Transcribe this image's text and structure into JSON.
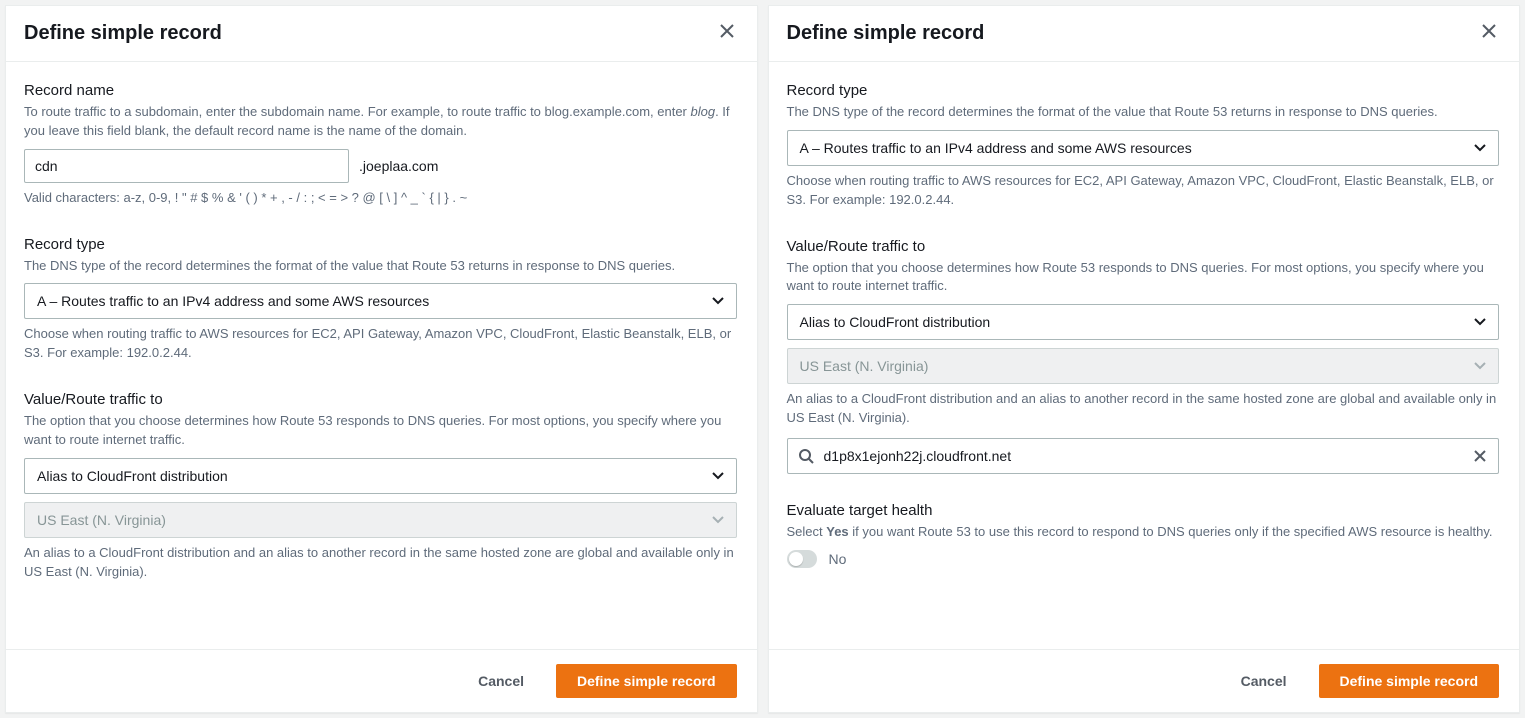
{
  "left": {
    "title": "Define simple record",
    "record_name": {
      "label": "Record name",
      "desc_pre": "To route traffic to a subdomain, enter the subdomain name. For example, to route traffic to blog.example.com, enter ",
      "desc_em": "blog",
      "desc_post": ". If you leave this field blank, the default record name is the name of the domain.",
      "value": "cdn",
      "suffix": ".joeplaa.com",
      "hint": "Valid characters: a-z, 0-9, ! \" # $ % & ' ( ) * + , - / : ; < = > ? @ [ \\ ] ^ _ ` { | } . ~"
    },
    "record_type": {
      "label": "Record type",
      "desc": "The DNS type of the record determines the format of the value that Route 53 returns in response to DNS queries.",
      "value": "A – Routes traffic to an IPv4 address and some AWS resources",
      "hint": "Choose when routing traffic to AWS resources for EC2, API Gateway, Amazon VPC, CloudFront, Elastic Beanstalk, ELB, or S3. For example: 192.0.2.44."
    },
    "route_to": {
      "label": "Value/Route traffic to",
      "desc": "The option that you choose determines how Route 53 responds to DNS queries. For most options, you specify where you want to route internet traffic.",
      "alias_value": "Alias to CloudFront distribution",
      "region_value": "US East (N. Virginia)",
      "hint": "An alias to a CloudFront distribution and an alias to another record in the same hosted zone are global and available only in US East (N. Virginia)."
    },
    "footer": {
      "cancel": "Cancel",
      "primary": "Define simple record"
    }
  },
  "right": {
    "title": "Define simple record",
    "record_type": {
      "label": "Record type",
      "desc": "The DNS type of the record determines the format of the value that Route 53 returns in response to DNS queries.",
      "value": "A – Routes traffic to an IPv4 address and some AWS resources",
      "hint": "Choose when routing traffic to AWS resources for EC2, API Gateway, Amazon VPC, CloudFront, Elastic Beanstalk, ELB, or S3. For example: 192.0.2.44."
    },
    "route_to": {
      "label": "Value/Route traffic to",
      "desc": "The option that you choose determines how Route 53 responds to DNS queries. For most options, you specify where you want to route internet traffic.",
      "alias_value": "Alias to CloudFront distribution",
      "region_value": "US East (N. Virginia)",
      "hint": "An alias to a CloudFront distribution and an alias to another record in the same hosted zone are global and available only in US East (N. Virginia).",
      "search_value": "d1p8x1ejonh22j.cloudfront.net"
    },
    "eval_health": {
      "label": "Evaluate target health",
      "desc_pre": "Select ",
      "desc_bold": "Yes",
      "desc_post": " if you want Route 53 to use this record to respond to DNS queries only if the specified AWS resource is healthy.",
      "toggle_label": "No"
    },
    "footer": {
      "cancel": "Cancel",
      "primary": "Define simple record"
    }
  }
}
